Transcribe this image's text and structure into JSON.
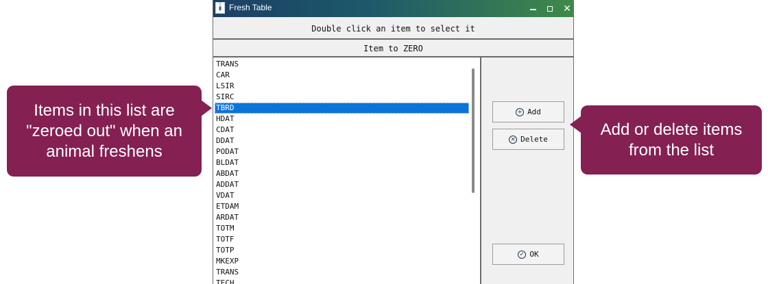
{
  "window": {
    "title": "Fresh Table",
    "controls": {
      "minimize": "–",
      "maximize": "□",
      "close": "✕"
    }
  },
  "instruction": "Double click an item to select it",
  "column_header": "Item to ZERO",
  "list": {
    "items": [
      "TRANS",
      "CAR",
      "LSIR",
      "SIRC",
      "TBRD",
      "HDAT",
      "CDAT",
      "DDAT",
      "PODAT",
      "BLDAT",
      "ABDAT",
      "ADDAT",
      "VDAT",
      "ETDAM",
      "ARDAT",
      "TOTM",
      "TOTF",
      "TOTP",
      "MKEXP",
      "TRANS",
      "TECH"
    ],
    "selected_index": 4
  },
  "buttons": {
    "add": {
      "label": "Add",
      "icon": "plus-circle-icon"
    },
    "delete": {
      "label": "Delete",
      "icon": "x-circle-icon"
    },
    "ok": {
      "label": "OK",
      "icon": "check-circle-icon"
    }
  },
  "callouts": {
    "left": [
      "Items in this list are",
      "\"zeroed out\" when an",
      "animal freshens"
    ],
    "right": [
      "Add or delete items",
      "from the list"
    ]
  },
  "colors": {
    "callout": "#852052",
    "selection": "#0b74d8"
  }
}
